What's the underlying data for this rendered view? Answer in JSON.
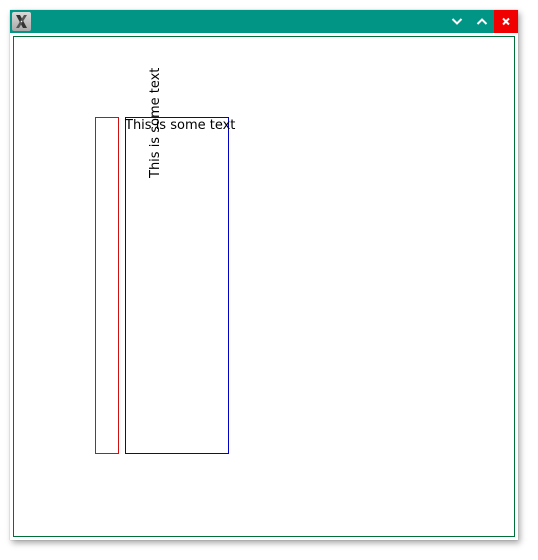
{
  "window": {
    "titlebar_color": "#009585",
    "close_button_color": "#f00000",
    "client_border_color": "#006f3a"
  },
  "titlebar": {
    "app_icon": "x-app-icon",
    "buttons": [
      {
        "name": "minimize",
        "icon": "chevron-down-icon"
      },
      {
        "name": "maximize",
        "icon": "chevron-up-icon"
      },
      {
        "name": "close",
        "icon": "close-icon"
      }
    ]
  },
  "canvas": {
    "red_rect_color": "#d01010",
    "blue_rect_color": "#0000c8",
    "horizontal_text": "This is some text",
    "vertical_text": "This is some text"
  }
}
